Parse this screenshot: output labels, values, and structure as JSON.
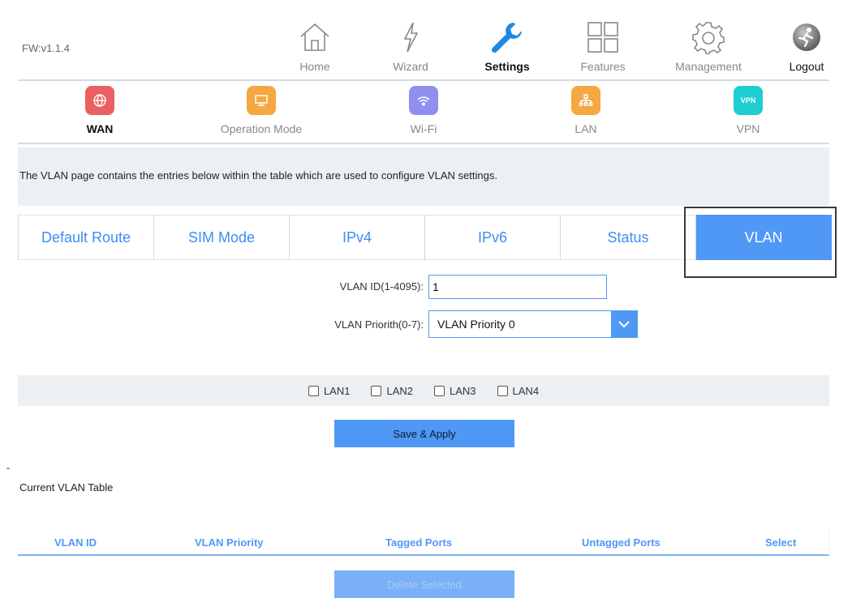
{
  "firmware": "FW:v1.1.4",
  "nav": {
    "home": "Home",
    "wizard": "Wizard",
    "settings": "Settings",
    "features": "Features",
    "management": "Management",
    "logout": "Logout"
  },
  "subnav": {
    "wan": "WAN",
    "operation_mode": "Operation Mode",
    "wifi": "Wi-Fi",
    "lan": "LAN",
    "vpn": "VPN",
    "vpn_badge": "VPN"
  },
  "colors": {
    "accent": "#4f98f5",
    "wan": "#ea5f61",
    "operation_mode": "#f5a742",
    "wifi": "#8f8ff0",
    "lan": "#f5a742",
    "vpn": "#1fcfcf"
  },
  "info_text": "The VLAN page contains the entries below within the table which are used to configure VLAN settings.",
  "tabs": {
    "default_route": "Default Route",
    "sim_mode": "SIM Mode",
    "ipv4": "IPv4",
    "ipv6": "IPv6",
    "status": "Status",
    "vlan": "VLAN"
  },
  "form": {
    "vlan_id_label": "VLAN ID(1-4095):",
    "vlan_id_value": "1",
    "priority_label": "VLAN Priorith(0-7):",
    "priority_value": "VLAN Priority 0"
  },
  "ports": {
    "lan1": "LAN1",
    "lan2": "LAN2",
    "lan3": "LAN3",
    "lan4": "LAN4"
  },
  "save_button": "Save & Apply",
  "dash": "-",
  "table": {
    "title": "Current VLAN Table",
    "col_vlan_id": "VLAN ID",
    "col_vlan_priority": "VLAN Priority",
    "col_tagged": "Tagged Ports",
    "col_untagged": "Untagged Ports",
    "col_select": "Select"
  },
  "delete_button": "Delete Selected"
}
